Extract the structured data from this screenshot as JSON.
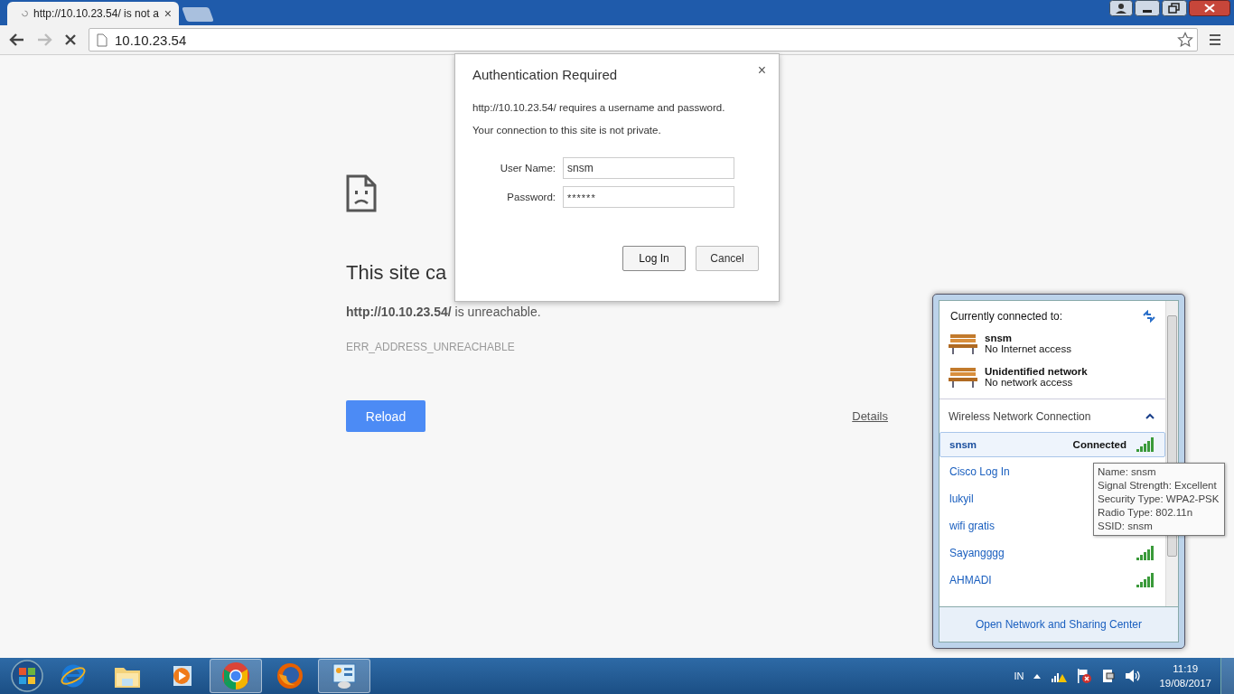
{
  "tabs": [
    {
      "title": "http://10.10.23.54/ is not a",
      "loading": true,
      "selected": true,
      "close": "×"
    }
  ],
  "toolbar": {
    "address": "10.10.23.54",
    "back_enabled": true,
    "forward_enabled": false
  },
  "error_page": {
    "heading": "This site ca",
    "message": "**http://10.10.23.54/** is unreachable.",
    "code": "ERR_ADDRESS_UNREACHABLE",
    "reload": "Reload",
    "details": "Details"
  },
  "auth_dialog": {
    "title": "Authentication Required",
    "close": "×",
    "lines": [
      "http://10.10.23.54/ requires a username and password.",
      "Your connection to this site is not private."
    ],
    "fields": [
      {
        "label": "User Name:",
        "value": "snsm",
        "kind": "text"
      },
      {
        "label": "Password:",
        "value": "******",
        "kind": "password"
      }
    ],
    "buttons": [
      {
        "label": "Log In",
        "default": true
      },
      {
        "label": "Cancel",
        "default": false
      }
    ]
  },
  "network_flyout": {
    "header": "Currently connected to:",
    "connections": [
      {
        "name": "snsm",
        "status": "No Internet access"
      },
      {
        "name": "Unidentified network",
        "status": "No network access"
      }
    ],
    "section": "Wireless Network Connection",
    "expanded": true,
    "networks": [
      {
        "name": "snsm",
        "status": "Connected",
        "selected": true,
        "signal_visible": true
      },
      {
        "name": "Cisco Log In",
        "selected": false,
        "signal_visible": false
      },
      {
        "name": "lukyil",
        "selected": false,
        "signal_visible": false
      },
      {
        "name": "wifi gratis",
        "selected": false,
        "signal_visible": false
      },
      {
        "name": "Sayangggg",
        "selected": false,
        "signal_visible": true
      },
      {
        "name": "AHMADI",
        "selected": false,
        "signal_visible": true
      }
    ],
    "footer": "Open Network and Sharing Center"
  },
  "tooltip": {
    "lines": [
      "Name: snsm",
      "Signal Strength: Excellent",
      "Security Type: WPA2-PSK",
      "Radio Type: 802.11n",
      "SSID: snsm"
    ]
  },
  "taskbar": {
    "apps": [
      {
        "kind": "ie",
        "active": false
      },
      {
        "kind": "explorer",
        "active": false
      },
      {
        "kind": "media",
        "active": false
      },
      {
        "kind": "chrome",
        "active": true
      },
      {
        "kind": "firefox",
        "active": false
      },
      {
        "kind": "control",
        "active": true
      }
    ],
    "language": "IN",
    "time": "11:19",
    "date": "19/08/2017"
  }
}
